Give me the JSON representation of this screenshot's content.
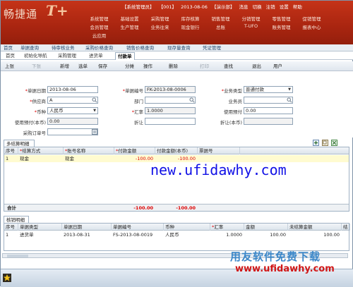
{
  "header": {
    "logo_text": "畅捷通",
    "logo_mark": "T+",
    "status_items": [
      "【系统管理员】",
      "【001】",
      "2013-08-06",
      "【演示部】"
    ],
    "status_links": [
      "消息",
      "切换",
      "注销",
      "设置",
      "帮助"
    ],
    "menu_row1": [
      "系统管理",
      "基础设置",
      "采购管理",
      "库存核算",
      "销售管理",
      "分销管理",
      "零售管理",
      "促销管理"
    ],
    "menu_row2": [
      "会员管理",
      "生产管理",
      "业务往来",
      "现金银行",
      "总账",
      "T-UFO",
      "账务管理",
      "报表中心"
    ],
    "menu_row3": [
      "云应用"
    ]
  },
  "tabbar": {
    "items": [
      "首页",
      "单据查询",
      "待审核业务",
      "采购价格查询",
      "销售价格查询",
      "现存量查询",
      "凭证管理"
    ]
  },
  "subtabs": {
    "items": [
      "首页",
      "初始化导航",
      "采购管理",
      "进货单",
      "付款单"
    ],
    "active": "付款单"
  },
  "toolbar": {
    "items": [
      "上张",
      "下张",
      "新增",
      "选单",
      "保存",
      "分摊",
      "操作",
      "删除",
      "打印",
      "查找",
      "退出",
      "用户"
    ]
  },
  "form": {
    "doc_date_label": "单据日期",
    "doc_date": "2013-08-06",
    "doc_no_label": "单据编号",
    "doc_no": "FK-2013-08-0006",
    "biz_type_label": "业务类型",
    "biz_type": "普通付款",
    "supplier_label": "供应商",
    "supplier": "A",
    "dept_label": "部门",
    "dept": "",
    "staff_label": "业务员",
    "staff": "",
    "currency_label": "币种",
    "currency": "人民币",
    "rate_label": "汇率",
    "rate": "1.0000",
    "use_prepay_label": "使用预付",
    "use_prepay": "0.00",
    "use_prepay_local_label": "使用预付(本币)",
    "use_prepay_local": "0.00",
    "discount_label": "折让",
    "discount": "",
    "discount_local_label": "折让(本币)",
    "discount_local": "",
    "po_label": "采购订单号",
    "po": ""
  },
  "settle": {
    "title": "多结算明细",
    "headers": [
      "序号",
      "结算方式",
      "账号名称",
      "付款金额",
      "付款金额(本币)",
      "票据号"
    ],
    "rows": [
      [
        "1",
        "现金",
        "现金",
        "-100.00",
        "-100.00",
        ""
      ]
    ],
    "sum_label": "合计",
    "sum_amount": "-100.00",
    "sum_amount_local": "-100.00"
  },
  "writeoff": {
    "title": "核销明细",
    "headers": [
      "序号",
      "单据类型",
      "单据日期",
      "单据编号",
      "币种",
      "汇率",
      "金额",
      "未结算金额",
      "结"
    ],
    "rows": [
      [
        "1",
        "进货单",
        "2013-08-31",
        "FS-2013-08-0019",
        "人民币",
        "1.0000",
        "100.00",
        "100.00",
        ""
      ]
    ]
  },
  "watermark": {
    "url": "new.ufidawhy.com",
    "brand": "用友软件免费下载",
    "url2": "www.ufidawhy.com"
  }
}
